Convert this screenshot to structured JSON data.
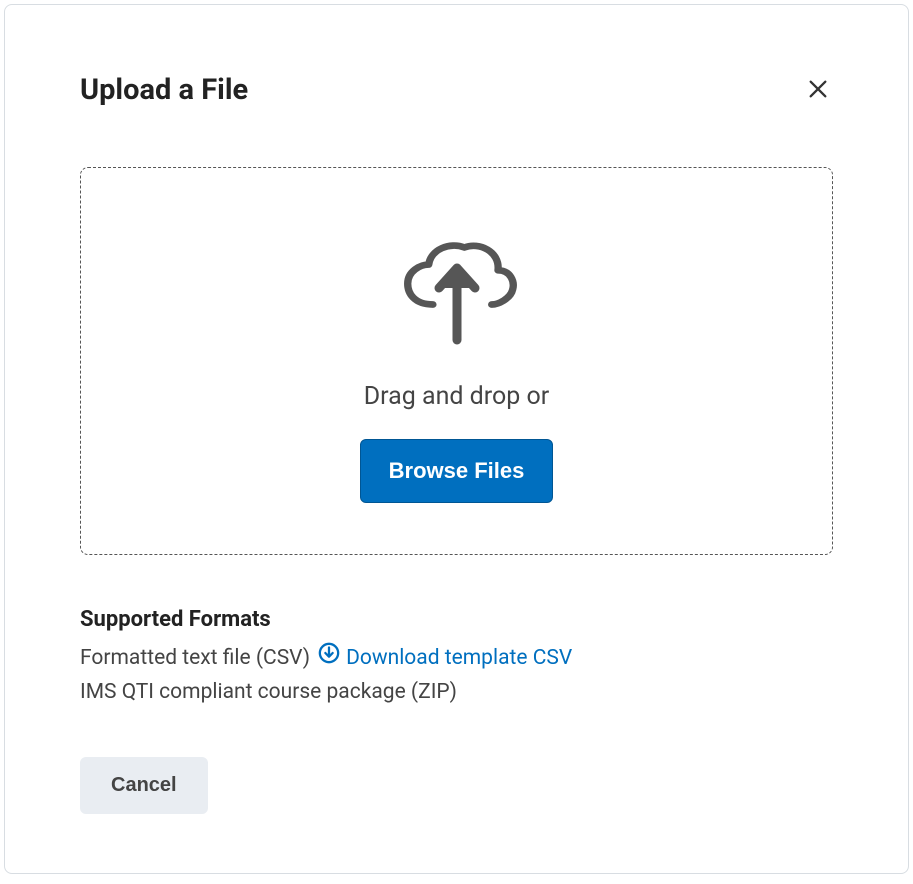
{
  "header": {
    "title": "Upload a File"
  },
  "dropzone": {
    "prompt": "Drag and drop or",
    "browse_label": "Browse Files"
  },
  "supported": {
    "heading": "Supported Formats",
    "format1_prefix": "Formatted text file (CSV)",
    "download_link_text": "Download template CSV",
    "format2": "IMS QTI compliant course package (ZIP)"
  },
  "footer": {
    "cancel_label": "Cancel"
  }
}
